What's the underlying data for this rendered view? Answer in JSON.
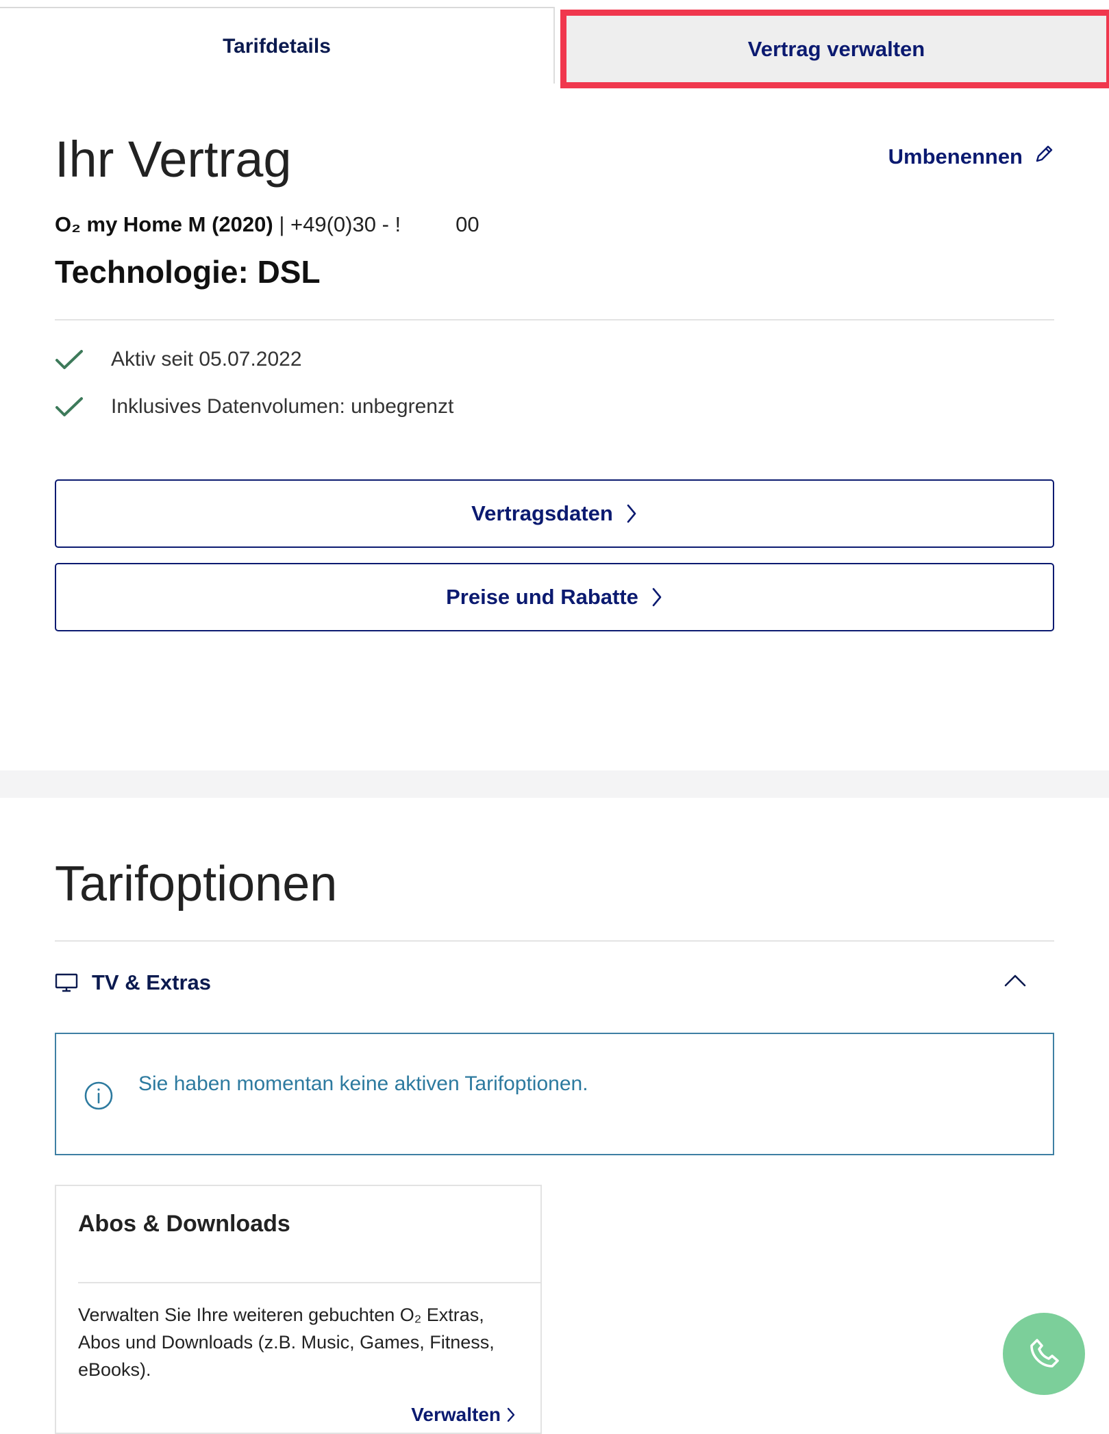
{
  "tabs": {
    "tab1": "Tarifdetails",
    "tab2": "Vertrag verwalten"
  },
  "contract": {
    "heading": "Ihr Vertrag",
    "rename": "Umbenennen",
    "tariff_name": "O₂ my Home M (2020)",
    "separator": " | ",
    "phone_prefix": "+49(0)30 - !",
    "phone_suffix": "00",
    "technology": "Technologie: DSL",
    "features": [
      "Aktiv seit 05.07.2022",
      "Inklusives Datenvolumen: unbegrenzt"
    ],
    "buttons": {
      "contract_data": "Vertragsdaten",
      "prices": "Preise und Rabatte"
    }
  },
  "options": {
    "heading": "Tarifoptionen",
    "accordion_label": "TV & Extras",
    "info": "Sie haben momentan keine aktiven Tarifoptionen."
  },
  "card": {
    "title": "Abos & Downloads",
    "description": "Verwalten Sie Ihre weiteren gebuchten O₂ Extras, Abos und Downloads (z.B. Music, Games, Fitness, eBooks).",
    "link": "Verwalten"
  },
  "colors": {
    "brand_navy": "#0b1a70",
    "highlight_red": "#f0374d",
    "check_green": "#3d7a5a",
    "info_teal": "#2d7a9f",
    "call_green": "#7ccf9a"
  },
  "icons": [
    "pencil-icon",
    "check-icon",
    "chevron-right-icon",
    "tv-icon",
    "chevron-up-icon",
    "info-icon",
    "phone-icon"
  ]
}
